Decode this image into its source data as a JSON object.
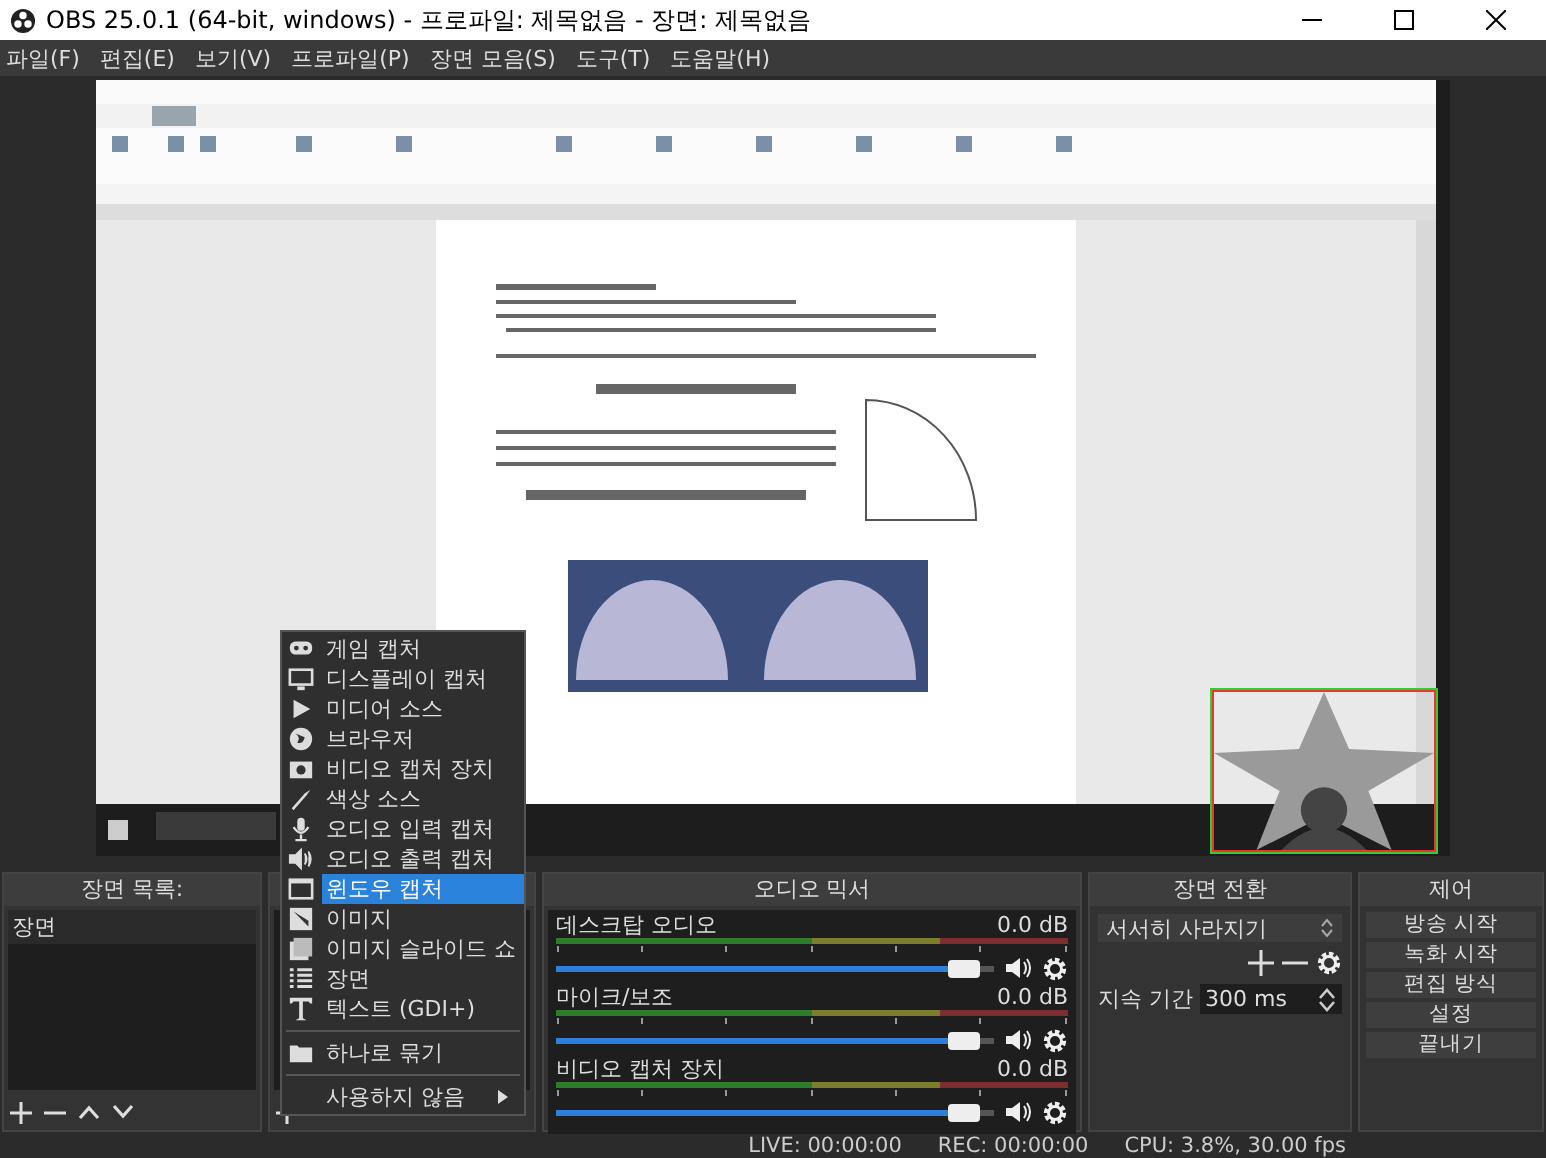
{
  "window": {
    "title": "OBS 25.0.1 (64-bit, windows) - 프로파일: 제목없음 - 장면: 제목없음"
  },
  "menu_bar": [
    "파일(F)",
    "편집(E)",
    "보기(V)",
    "프로파일(P)",
    "장면 모음(S)",
    "도구(T)",
    "도움말(H)"
  ],
  "scenes": {
    "title": "장면 목록:",
    "items": [
      {
        "label": "장면"
      }
    ]
  },
  "context_menu": {
    "items": [
      {
        "kind": "item",
        "label": "게임 캡처",
        "selected": false,
        "submenu": false
      },
      {
        "kind": "item",
        "label": "디스플레이 캡처",
        "selected": false,
        "submenu": false
      },
      {
        "kind": "item",
        "label": "미디어 소스",
        "selected": false,
        "submenu": false
      },
      {
        "kind": "item",
        "label": "브라우저",
        "selected": false,
        "submenu": false
      },
      {
        "kind": "item",
        "label": "비디오 캡처 장치",
        "selected": false,
        "submenu": false
      },
      {
        "kind": "item",
        "label": "색상 소스",
        "selected": false,
        "submenu": false
      },
      {
        "kind": "item",
        "label": "오디오 입력 캡처",
        "selected": false,
        "submenu": false
      },
      {
        "kind": "item",
        "label": "오디오 출력 캡처",
        "selected": false,
        "submenu": false
      },
      {
        "kind": "item",
        "label": "윈도우 캡처",
        "selected": true,
        "submenu": false
      },
      {
        "kind": "item",
        "label": "이미지",
        "selected": false,
        "submenu": false
      },
      {
        "kind": "item",
        "label": "이미지 슬라이드 쇼",
        "selected": false,
        "submenu": false
      },
      {
        "kind": "item",
        "label": "장면",
        "selected": false,
        "submenu": false
      },
      {
        "kind": "item",
        "label": "텍스트 (GDI+)",
        "selected": false,
        "submenu": false
      },
      {
        "kind": "separator"
      },
      {
        "kind": "item",
        "label": "하나로 묶기",
        "selected": false,
        "submenu": false
      },
      {
        "kind": "separator"
      },
      {
        "kind": "item",
        "label": "사용하지 않음",
        "selected": false,
        "submenu": true
      }
    ]
  },
  "audio_mixer": {
    "title": "오디오 믹서",
    "channels": [
      {
        "name": "데스크탑 오디오",
        "reading": "0.0 dB",
        "level": 0.97
      },
      {
        "name": "마이크/보조",
        "reading": "0.0 dB",
        "level": 0.97
      },
      {
        "name": "비디오 캡처 장치",
        "reading": "0.0 dB",
        "level": 0.97
      }
    ]
  },
  "transitions": {
    "title": "장면 전환",
    "transition": "서서히 사라지기",
    "duration_label": "지속 기간",
    "duration": "300 ms"
  },
  "controls": {
    "title": "제어",
    "buttons": [
      "방송 시작",
      "녹화 시작",
      "편집 방식",
      "설정",
      "끝내기"
    ]
  },
  "status_bar": {
    "live": "LIVE: 00:00:00",
    "rec": "REC: 00:00:00",
    "cpu": "CPU: 3.8%, 30.00 fps"
  }
}
